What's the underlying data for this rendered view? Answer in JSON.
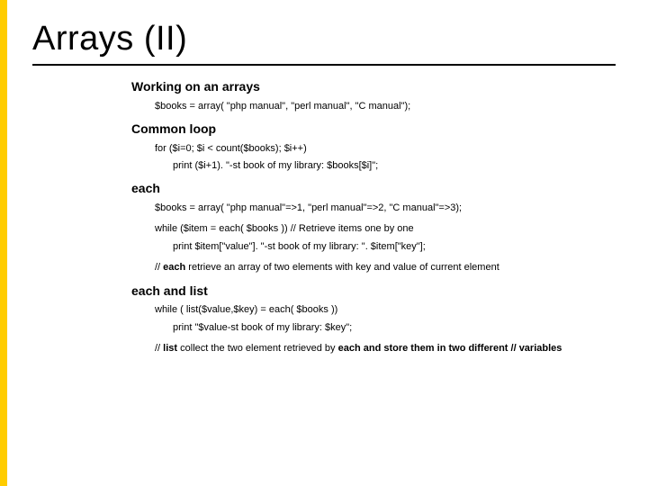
{
  "title": "Arrays (II)",
  "sections": {
    "working": {
      "heading": "Working on an arrays",
      "code1": "$books = array( \"php manual\", \"perl manual\", \"C manual\");"
    },
    "loop": {
      "heading": "Common loop",
      "code1": "for ($i=0; $i < count($books); $i++)",
      "code2": "print ($i+1). \"-st book of my library: $books[$i]\";"
    },
    "each": {
      "heading": "each",
      "code1": "$books = array( \"php manual\"=>1, \"perl manual\"=>2, \"C manual\"=>3);",
      "code2": "while ($item = each( $books )) // Retrieve items one by one",
      "code3": "print $item[\"value\"]. \"-st book of my library: \". $item[\"key\"];",
      "note_pre": "// ",
      "note_bold": "each",
      "note_post": " retrieve an array of two elements with key and value of current element"
    },
    "eachlist": {
      "heading": "each and list",
      "code1": "while ( list($value,$key) = each( $books ))",
      "code2": "print \"$value-st book of my library: $key\";",
      "note_pre": "// ",
      "note_bold1": "list",
      "note_mid": " collect the two element retrieved by ",
      "note_bold2": "each and store them in two different // variables"
    }
  }
}
